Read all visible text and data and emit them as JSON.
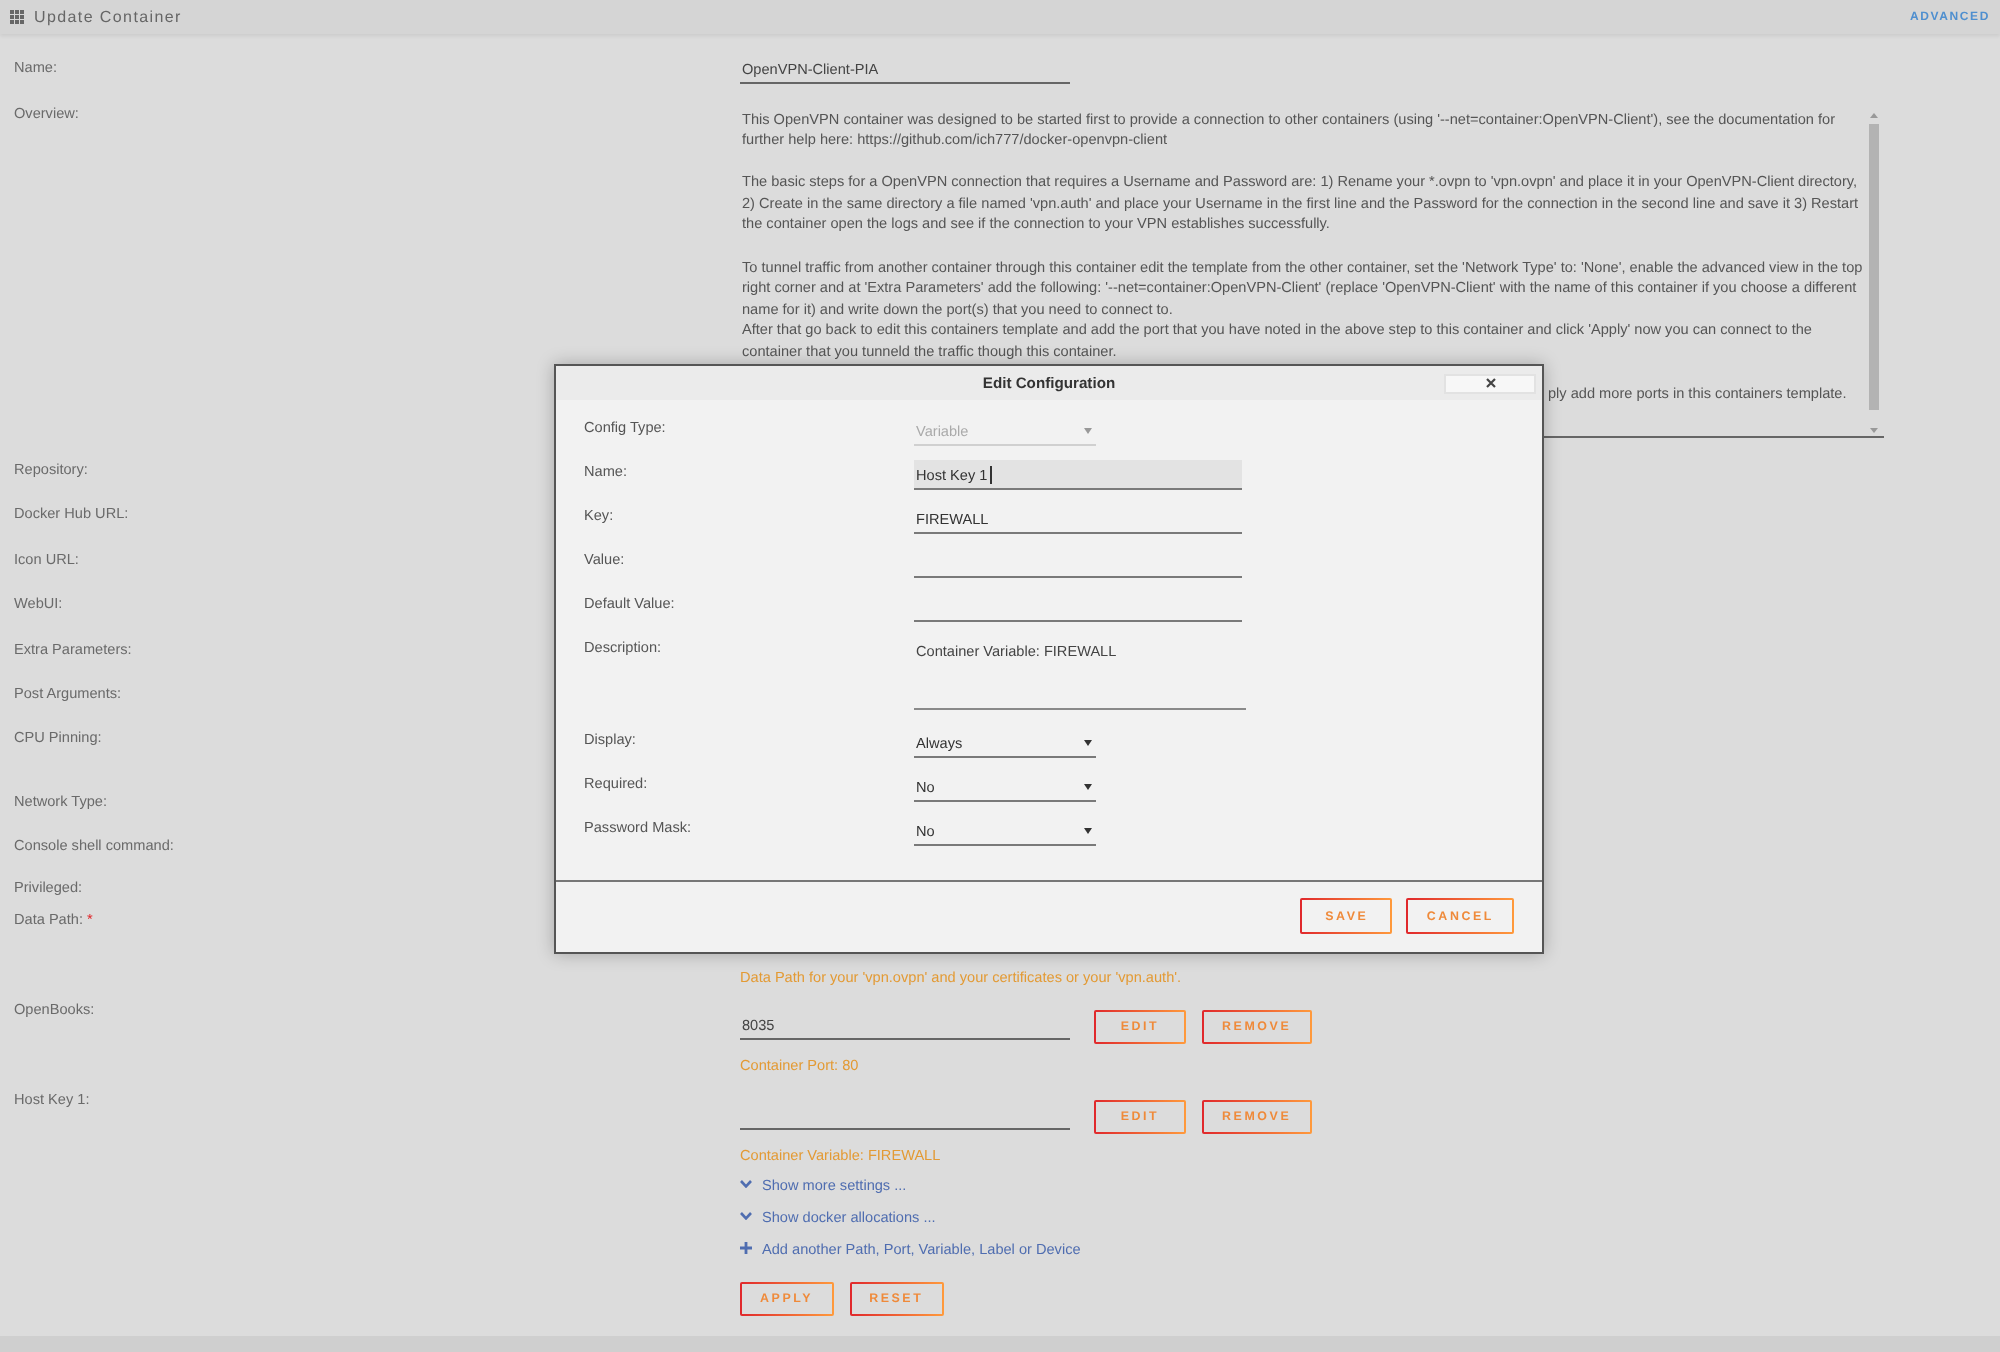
{
  "header": {
    "title": "Update Container",
    "link": "ADVANCED"
  },
  "form": {
    "rows": [
      {
        "kind": "input",
        "label": "Name:",
        "value": "OpenVPN-Client-PIA"
      },
      {
        "kind": "overview",
        "label": "Overview:",
        "blocks": [
          [
            "This OpenVPN container was designed to be started first to provide a connection to other containers (using '--net=container:OpenVPN-Client'), see the documentation for further help here: https://github.com/ich777/docker-openvpn-client"
          ],
          [
            "The basic steps for a OpenVPN connection that requires a Username and Password are: 1) Rename your *.ovpn to 'vpn.ovpn' and place it in your OpenVPN-Client directory, 2) Create in the same directory a file named 'vpn.auth' and place your Username in the first line and the Password for the connection in the second line and save it 3) Restart the container open the logs and see if the connection to your VPN establishes successfully."
          ],
          [
            "To tunnel traffic from another container through this container edit the template from the other container, set the 'Network Type' to: 'None', enable the advanced view in the top right corner and at 'Extra Parameters' add the following: '--net=container:OpenVPN-Client' (replace 'OpenVPN-Client' with the name of this container if you choose a different name for it) and write down the port(s) that you need to connect to.",
            "After that go back to edit this containers template and add the port that you have noted in the above step to this container and click 'Apply' now you can connect to the container that you tunneld the traffic though this container."
          ]
        ],
        "fragment": "ply add more ports in this containers template."
      },
      {
        "kind": "label",
        "label": "Repository:"
      },
      {
        "kind": "label",
        "label": "Docker Hub URL:"
      },
      {
        "kind": "label",
        "label": "Icon URL:"
      },
      {
        "kind": "label",
        "label": "WebUI:"
      },
      {
        "kind": "label",
        "label": "Extra Parameters:"
      },
      {
        "kind": "label",
        "label": "Post Arguments:"
      },
      {
        "kind": "label",
        "label": "CPU Pinning:"
      },
      {
        "kind": "label",
        "label": "Network Type:"
      },
      {
        "kind": "label",
        "label": "Console shell command:"
      },
      {
        "kind": "label",
        "label": "Privileged:"
      },
      {
        "kind": "path",
        "label": "Data Path:",
        "required_mark": "*",
        "note": "Data Path for your 'vpn.ovpn' and your certificates or your 'vpn.auth'."
      },
      {
        "kind": "port",
        "label": "OpenBooks:",
        "value": "8035",
        "buttons": [
          "EDIT",
          "REMOVE"
        ],
        "note": "Container Port: 80"
      },
      {
        "kind": "port",
        "label": "Host Key 1:",
        "buttons": [
          "EDIT",
          "REMOVE"
        ],
        "note": "Container Variable: FIREWALL"
      }
    ],
    "links": [
      {
        "kind": "toggle",
        "text": "Show more settings ..."
      },
      {
        "kind": "toggle",
        "text": "Show docker allocations ..."
      },
      {
        "kind": "add",
        "text": "Add another Path, Port, Variable, Label or Device"
      }
    ],
    "buttons": [
      "APPLY",
      "RESET"
    ]
  },
  "dialog": {
    "title": "Edit Configuration",
    "fields": [
      {
        "kind": "select",
        "label": "Config Type:",
        "value": "Variable",
        "disabled": true,
        "focused": false
      },
      {
        "kind": "input",
        "label": "Name:",
        "value": "Host Key 1",
        "disabled": false,
        "focused": true
      },
      {
        "kind": "input",
        "label": "Key:",
        "value": "FIREWALL",
        "disabled": false,
        "focused": false
      },
      {
        "kind": "input",
        "label": "Value:",
        "disabled": false,
        "focused": false
      },
      {
        "kind": "input",
        "label": "Default Value:",
        "disabled": false,
        "focused": false
      },
      {
        "kind": "textarea",
        "label": "Description:",
        "value": "Container Variable: FIREWALL",
        "disabled": false,
        "focused": false
      },
      {
        "kind": "select",
        "label": "Display:",
        "value": "Always",
        "disabled": false,
        "focused": false
      },
      {
        "kind": "select",
        "label": "Required:",
        "value": "No",
        "disabled": false,
        "focused": false
      },
      {
        "kind": "select",
        "label": "Password Mask:",
        "value": "No",
        "disabled": false,
        "focused": false
      }
    ],
    "buttons": [
      "SAVE",
      "CANCEL"
    ]
  }
}
